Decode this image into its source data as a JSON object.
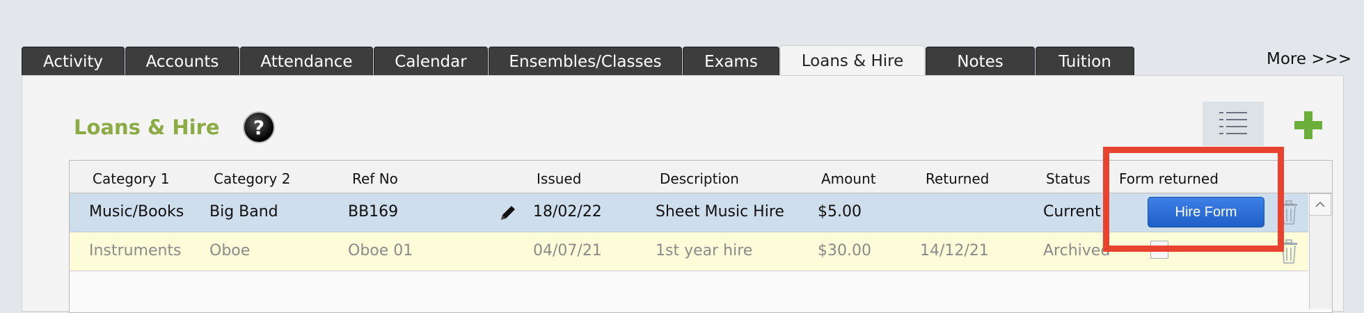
{
  "tabs": [
    {
      "label": "Activity",
      "active": false
    },
    {
      "label": "Accounts",
      "active": false
    },
    {
      "label": "Attendance",
      "active": false
    },
    {
      "label": "Calendar",
      "active": false
    },
    {
      "label": "Ensembles/Classes",
      "active": false
    },
    {
      "label": "Exams",
      "active": false
    },
    {
      "label": "Loans & Hire",
      "active": true
    },
    {
      "label": "Notes",
      "active": false
    },
    {
      "label": "Tuition",
      "active": false
    }
  ],
  "more_label": "More >>>",
  "page": {
    "title": "Loans & Hire",
    "help_glyph": "?"
  },
  "table": {
    "columns": [
      "Category 1",
      "Category 2",
      "Ref No",
      "Issued",
      "Description",
      "Amount",
      "Returned",
      "Status",
      "Form returned"
    ],
    "rows": [
      {
        "category1": "Music/Books",
        "category2": "Big Band",
        "ref_no": "BB169",
        "issued": "18/02/22",
        "description": "Sheet Music Hire",
        "amount": "$5.00",
        "returned": "",
        "status": "Current",
        "form_button": "Hire Form"
      },
      {
        "category1": "Instruments",
        "category2": "Oboe",
        "ref_no": "Oboe 01",
        "issued": "04/07/21",
        "description": "1st year hire",
        "amount": "$30.00",
        "returned": "14/12/21",
        "status": "Archived",
        "form_checked": false
      }
    ]
  },
  "colors": {
    "accent_green": "#8bab45",
    "plus_green": "#6cae3a",
    "selected_row": "#cfdeed",
    "archived_row": "#fdfcd9",
    "button_blue": "#2d6fd8",
    "highlight_red": "#e8432e"
  },
  "icons": {
    "help": "help-icon",
    "list_view": "list-view-icon",
    "add": "plus-icon",
    "edit": "pencil-icon",
    "delete": "trash-icon",
    "scroll_up": "chevron-up-icon"
  }
}
